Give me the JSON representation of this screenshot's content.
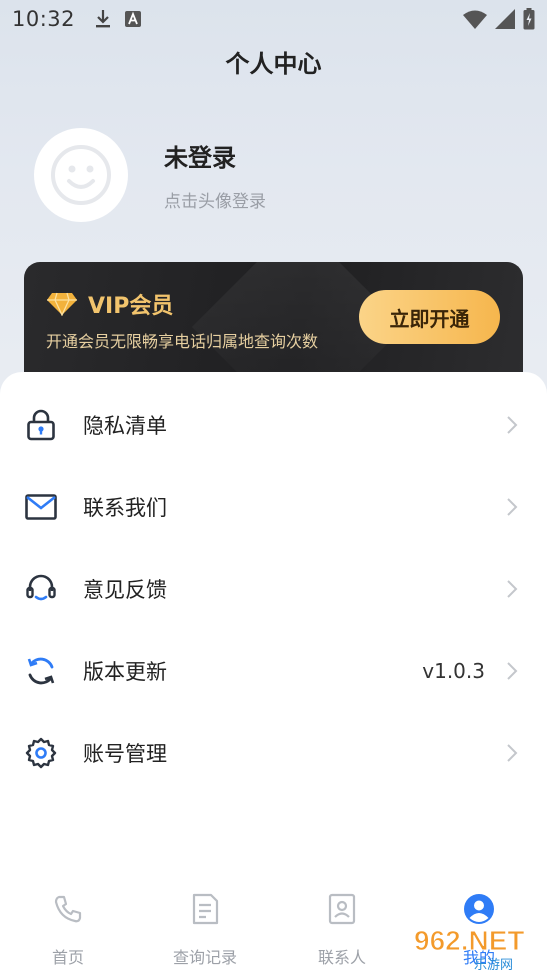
{
  "status_bar": {
    "time": "10:32",
    "icons": [
      "download-icon",
      "a-icon",
      "wifi-icon",
      "signal-icon",
      "battery-icon"
    ]
  },
  "header": {
    "title": "个人中心"
  },
  "profile": {
    "name": "未登录",
    "subtitle": "点击头像登录",
    "avatar_icon": "smiley-avatar-icon"
  },
  "vip": {
    "title": "VIP会员",
    "description": "开通会员无限畅享电话归属地查询次数",
    "button_label": "立即开通",
    "icon": "diamond-icon",
    "accent_color": "#f2c46d"
  },
  "menu": {
    "items": [
      {
        "label": "隐私清单",
        "icon": "lock-icon",
        "value": ""
      },
      {
        "label": "联系我们",
        "icon": "mail-icon",
        "value": ""
      },
      {
        "label": "意见反馈",
        "icon": "headset-icon",
        "value": ""
      },
      {
        "label": "版本更新",
        "icon": "refresh-icon",
        "value": "v1.0.3"
      },
      {
        "label": "账号管理",
        "icon": "gear-icon",
        "value": ""
      }
    ]
  },
  "tabs": [
    {
      "label": "首页",
      "icon": "phone-icon",
      "active": false
    },
    {
      "label": "查询记录",
      "icon": "document-icon",
      "active": false
    },
    {
      "label": "联系人",
      "icon": "contact-book-icon",
      "active": false
    },
    {
      "label": "我的",
      "icon": "user-icon",
      "active": true
    }
  ],
  "watermark": {
    "text": "962.NET",
    "subtext": "乐游网"
  },
  "colors": {
    "active_tab": "#2f7cf6",
    "inactive_tab": "#9da1a8",
    "refresh_blue": "#2f7cf6"
  }
}
